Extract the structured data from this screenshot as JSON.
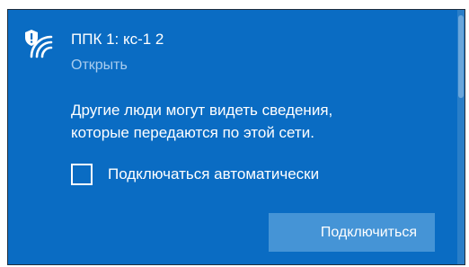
{
  "network": {
    "name": "ППК 1: кс-1 2",
    "open_link": "Открыть",
    "icon": "wifi-shield-icon"
  },
  "warning": {
    "line1": "Другие люди могут видеть сведения,",
    "line2": "которые передаются по этой сети."
  },
  "autoconnect": {
    "label": "Подключаться автоматически",
    "checked": false
  },
  "connect_button": {
    "label": "Подключиться"
  },
  "colors": {
    "panel_background": "#0a6cc3",
    "button_background": "#4594d6",
    "link_color": "#a9cdef",
    "text_color": "#ffffff"
  }
}
